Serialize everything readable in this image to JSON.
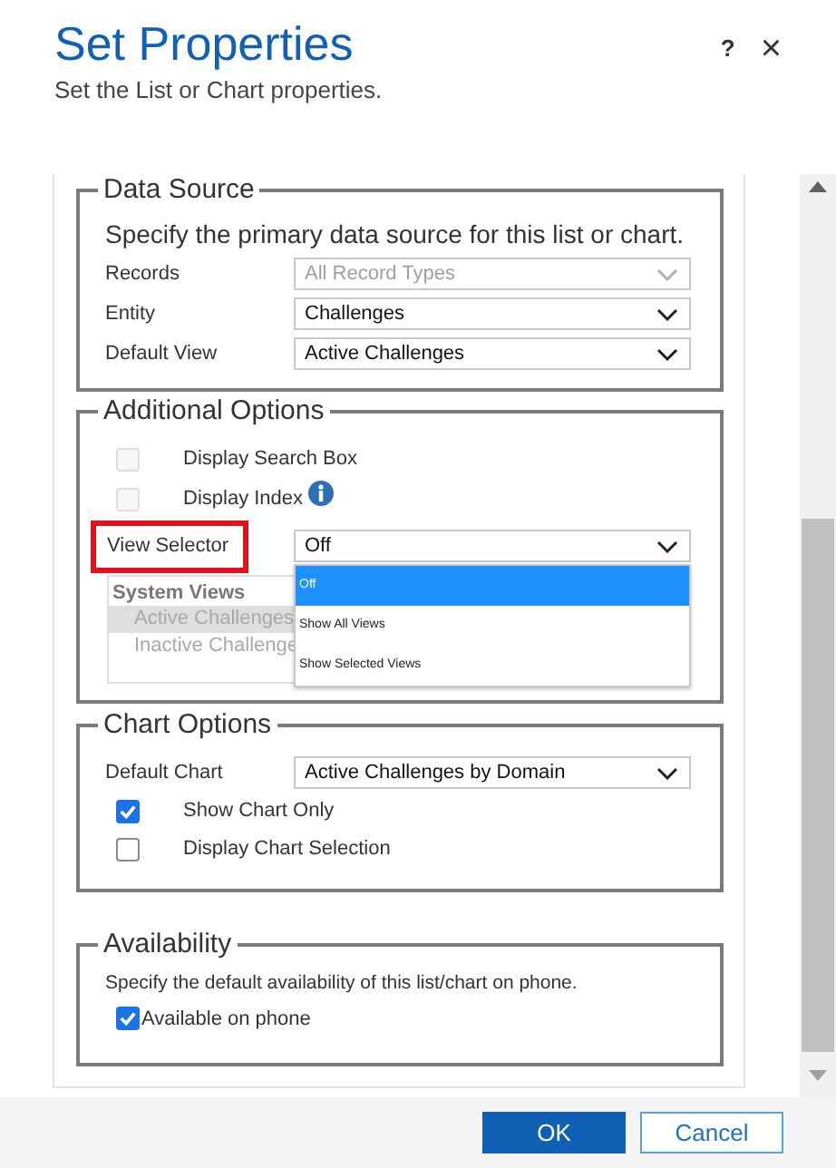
{
  "dialog": {
    "title": "Set Properties",
    "subtitle": "Set the List or Chart properties.",
    "help": "?",
    "close": "×"
  },
  "data_source": {
    "legend": "Data Source",
    "description": "Specify the primary data source for this list or chart.",
    "fields": [
      {
        "label": "Records",
        "value": "All Record Types",
        "disabled": true
      },
      {
        "label": "Entity",
        "value": "Challenges",
        "disabled": false
      },
      {
        "label": "Default View",
        "value": "Active Challenges",
        "disabled": false
      }
    ]
  },
  "additional_options": {
    "legend": "Additional Options",
    "checkboxes": [
      {
        "label": "Display Search Box",
        "checked": false,
        "disabled": true,
        "kind": "plain"
      },
      {
        "label": "Display Index",
        "checked": false,
        "disabled": true,
        "kind": "info"
      }
    ],
    "view_selector": {
      "label": "View Selector",
      "value": "Off",
      "highlighted": true,
      "options": [
        {
          "label": "Off",
          "selected": true
        },
        {
          "label": "Show All Views",
          "selected": false
        },
        {
          "label": "Show Selected Views",
          "selected": false
        }
      ]
    },
    "system_views": {
      "header": "System Views",
      "items": [
        {
          "label": "Active Challenges",
          "selected": true
        },
        {
          "label": "Inactive Challenge",
          "selected": false
        }
      ]
    }
  },
  "chart_options": {
    "legend": "Chart Options",
    "default_chart": {
      "label": "Default Chart",
      "value": "Active Challenges by Domain"
    },
    "checkboxes": [
      {
        "label": "Show Chart Only",
        "checked": true
      },
      {
        "label": "Display Chart Selection",
        "checked": false
      }
    ]
  },
  "availability": {
    "legend": "Availability",
    "description": "Specify the default availability of this list/chart on phone.",
    "checkbox": {
      "label": "Available on phone",
      "checked": true
    }
  },
  "buttons": [
    {
      "label": "OK",
      "primary": true
    },
    {
      "label": "Cancel",
      "primary": false
    }
  ]
}
